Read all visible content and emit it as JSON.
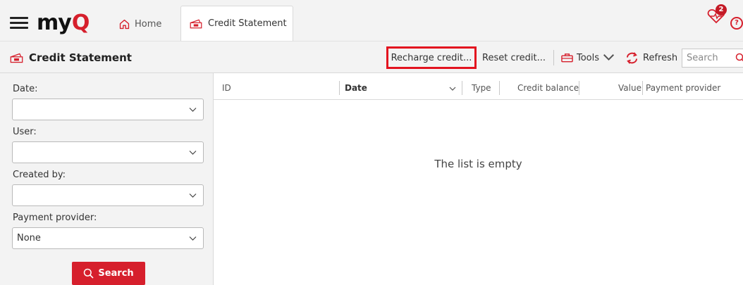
{
  "header": {
    "logo_my": "my",
    "logo_q": "Q",
    "home_tab": "Home",
    "active_tab": "Credit Statement",
    "notification_count": "2",
    "help_glyph": "?"
  },
  "toolbar": {
    "title": "Credit Statement",
    "recharge_label": "Recharge credit...",
    "reset_label": "Reset credit...",
    "tools_label": "Tools",
    "refresh_label": "Refresh",
    "search_placeholder": "Search"
  },
  "filters": {
    "date_label": "Date:",
    "date_value": "",
    "user_label": "User:",
    "user_value": "",
    "created_by_label": "Created by:",
    "created_by_value": "",
    "payment_provider_label": "Payment provider:",
    "payment_provider_value": "None",
    "search_button": "Search"
  },
  "grid": {
    "columns": [
      "ID",
      "Date",
      "Type",
      "Credit balance",
      "Value",
      "Payment provider"
    ],
    "empty_message": "The list is empty"
  },
  "colors": {
    "accent": "#d61f2c",
    "highlight_box": "#e3131f",
    "panel_bg": "#f3f3f3"
  },
  "icons": [
    "menu-icon",
    "home-icon",
    "credit-statement-icon",
    "notification-heart-icon",
    "help-icon",
    "toolbox-icon",
    "refresh-icon",
    "search-icon",
    "chevron-down-icon"
  ]
}
